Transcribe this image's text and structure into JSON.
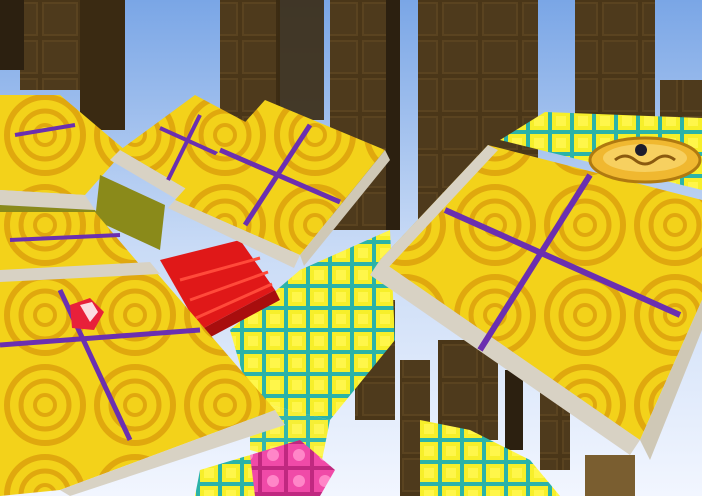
{
  "scene": {
    "kind": "3d-platformer-viewport",
    "palette": {
      "sky_top": "#7aa6e6",
      "sky_bottom": "#f2f6ff",
      "pillar_dark": "#3a2a12",
      "pillar_mid": "#5a4320",
      "pillar_light": "#7a5e30",
      "tile_yellow": "#f3d21a",
      "tile_ring": "#e0a80e",
      "tile_divider": "#6b2fb0",
      "tile_edge": "#d8d2c4",
      "grid_yellow": "#f7ef2a",
      "grid_line": "#2bb3a8",
      "red_steps": "#e01818",
      "pink_block": "#f04aa8",
      "gem_red": "#e8203a",
      "gem_white": "#ffffff",
      "coin_gold": "#f0b830",
      "coin_dark": "#1c1c2c"
    },
    "objects": {
      "pillars": "stacked-brick-columns",
      "platforms": "yellow-target-tiles",
      "pickup": "red-white-gem",
      "goal": "gold-coin-plate",
      "stairs": "red-steps",
      "floor": "yellow-grid-tiles",
      "block": "pink-block"
    }
  }
}
